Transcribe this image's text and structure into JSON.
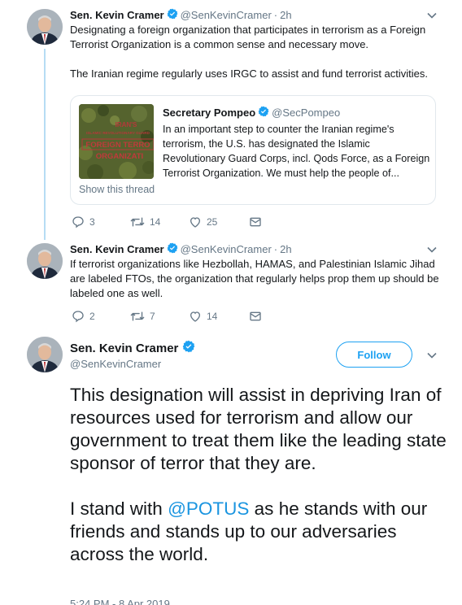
{
  "colors": {
    "accent": "#1da1f2",
    "link": "#1b95e0",
    "muted": "#657786",
    "thread_line": "#b6dcf4",
    "border": "#e1e8ed"
  },
  "tweets": [
    {
      "name": "Sen. Kevin Cramer",
      "handle": "@SenKevinCramer",
      "separator": "·",
      "time": "2h",
      "text_line1": "Designating a foreign organization that participates in terrorism as a Foreign Terrorist Organization is a common sense and necessary move.",
      "text_line2": "The Iranian regime regularly uses IRGC to assist and fund terrorist activities.",
      "quote": {
        "name": "Secretary Pompeo",
        "handle": "@SecPompeo",
        "text": "In an important step to counter the Iranian regime's terrorism, the U.S. has designated the Islamic Revolutionary Guard Corps, incl. Qods Force, as a Foreign Terrorist Organization. We must help the people of...",
        "image_text": [
          "IRAN'S",
          "ISLAMIC REVOLUTIONARY GUARD",
          "FOREIGN TERRO",
          "ORGANIZATI"
        ],
        "show_thread": "Show this thread"
      },
      "replies": "3",
      "retweets": "14",
      "likes": "25"
    },
    {
      "name": "Sen. Kevin Cramer",
      "handle": "@SenKevinCramer",
      "separator": "·",
      "time": "2h",
      "text": "If terrorist organizations like Hezbollah, HAMAS, and Palestinian Islamic Jihad are labeled FTOs, the organization that regularly helps prop them up should be labeled one as well.",
      "replies": "2",
      "retweets": "7",
      "likes": "14"
    }
  ],
  "main_tweet": {
    "name": "Sen. Kevin Cramer",
    "handle": "@SenKevinCramer",
    "follow_label": "Follow",
    "paragraph1": "This designation will assist in depriving Iran of resources used for terrorism and allow our government to treat them like the leading state sponsor of terror that they are.",
    "p2_before": "I stand with ",
    "p2_mention": "@POTUS",
    "p2_after": " as he stands with our friends and stands up to our adversaries across the world.",
    "timestamp": "5:24 PM - 8 Apr 2019"
  },
  "icons": {
    "verified": "verified-badge-icon",
    "caret": "chevron-down-icon",
    "reply": "reply-icon",
    "retweet": "retweet-icon",
    "like": "heart-icon",
    "dm": "envelope-icon"
  }
}
